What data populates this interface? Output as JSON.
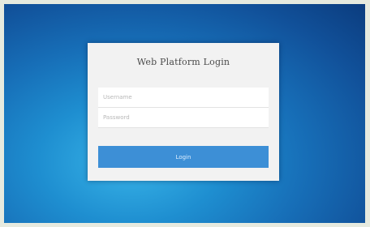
{
  "login": {
    "title": "Web Platform Login",
    "username_placeholder": "Username",
    "password_placeholder": "Password",
    "button_label": "Login"
  },
  "colors": {
    "background_dark": "#0b3c7e",
    "background_light": "#38b4e8",
    "card": "#f2f2f2",
    "button": "#3d8fd6"
  }
}
